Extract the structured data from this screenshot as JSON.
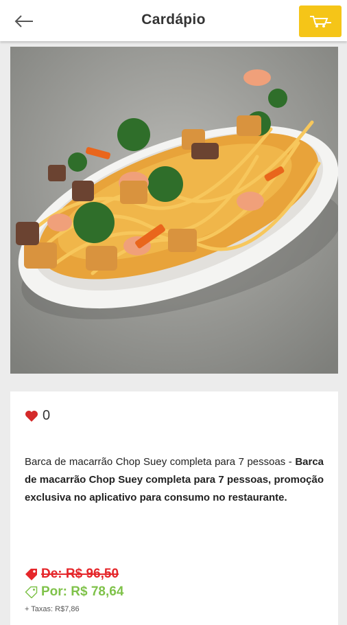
{
  "header": {
    "title": "Cardápio",
    "back_icon": "arrow-left-icon",
    "cart_icon": "shopping-cart-icon",
    "cart_color": "#f5c518"
  },
  "product": {
    "image_alt": "Barca de macarrão Chop Suey",
    "likes": "0",
    "description_plain": "Barca de macarrão Chop Suey completa para 7 pessoas -",
    "description_bold": "Barca de macarrão Chop Suey completa para 7 pessoas, promoção exclusiva no aplicativo para consumo no restaurante.",
    "old_price": "De: R$ 96,50",
    "new_price": "Por: R$ 78,64",
    "tax": "+ Taxas: R$7,86",
    "old_price_color": "#e5262a",
    "new_price_color": "#7fc24a"
  }
}
